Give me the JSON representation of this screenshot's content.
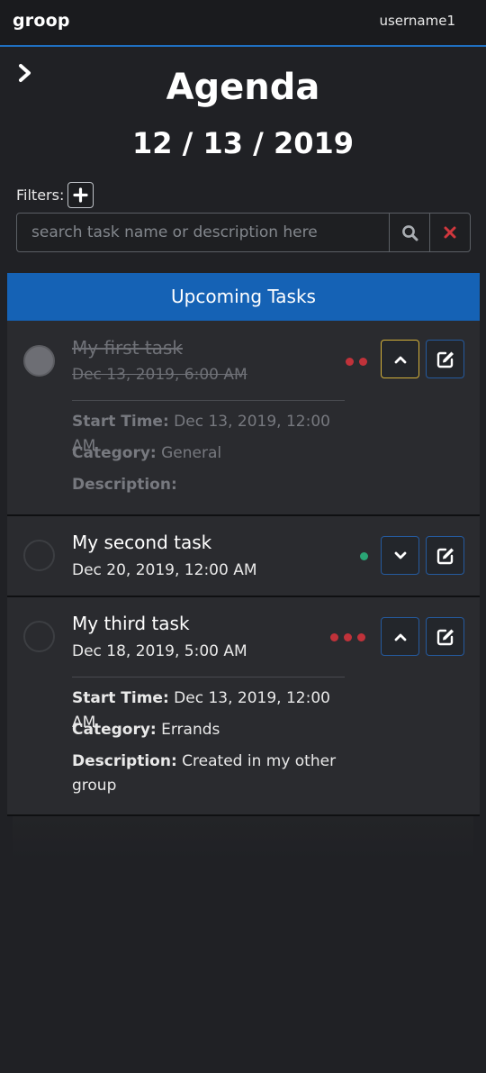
{
  "header": {
    "logo": "groop",
    "username": "username1"
  },
  "page": {
    "title": "Agenda",
    "date": "12 / 13 / 2019"
  },
  "filters": {
    "label": "Filters:"
  },
  "search": {
    "placeholder": "search task name or description here"
  },
  "panel": {
    "title": "Upcoming Tasks"
  },
  "labels": {
    "start_time": "Start Time:",
    "category": "Category:",
    "description": "Description:"
  },
  "tasks": [
    {
      "name": "My first task",
      "due": "Dec 13, 2019, 6:00 AM",
      "completed": true,
      "expanded": true,
      "priority_dots": 2,
      "priority_color": "#c0323a",
      "start_time": "Dec 13, 2019, 12:00 AM",
      "category": "General",
      "description": ""
    },
    {
      "name": "My second task",
      "due": "Dec 20, 2019, 12:00 AM",
      "completed": false,
      "expanded": false,
      "priority_dots": 1,
      "priority_color": "#2aa576"
    },
    {
      "name": "My third task",
      "due": "Dec 18, 2019, 5:00 AM",
      "completed": false,
      "expanded": true,
      "priority_dots": 3,
      "priority_color": "#c0323a",
      "start_time": "Dec 13, 2019, 12:00 AM",
      "category": "Errands",
      "description": "Created in my other group"
    }
  ],
  "icons": {
    "sidebar": "chevron-right-icon",
    "add_filter": "plus-icon",
    "search": "search-icon",
    "clear": "close-icon",
    "collapse": "chevron-up-icon",
    "expand": "chevron-down-icon",
    "edit": "edit-icon"
  },
  "colors": {
    "accent": "#1562b5",
    "clear": "#d0373d",
    "active_border": "#d4b13a"
  }
}
